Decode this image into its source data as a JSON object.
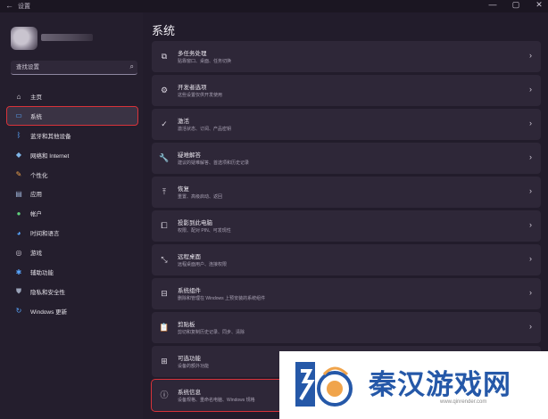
{
  "window": {
    "title": "设置",
    "controls": [
      "—",
      "▢",
      "✕"
    ]
  },
  "sidebar": {
    "search_placeholder": "查找设置",
    "items": [
      {
        "label": "主页",
        "icon": "home-icon",
        "glyph": "⌂",
        "color": "#e6e3ea"
      },
      {
        "label": "系统",
        "icon": "system-display-icon",
        "glyph": "▭",
        "color": "#58a6ff",
        "active": true
      },
      {
        "label": "蓝牙和其他设备",
        "icon": "bluetooth-icon",
        "glyph": "ᛒ",
        "color": "#58a6ff"
      },
      {
        "label": "网络和 Internet",
        "icon": "network-icon",
        "glyph": "◆",
        "color": "#7fb5e8"
      },
      {
        "label": "个性化",
        "icon": "brush-icon",
        "glyph": "✎",
        "color": "#f0a44b"
      },
      {
        "label": "应用",
        "icon": "apps-icon",
        "glyph": "▤",
        "color": "#9fb4d8"
      },
      {
        "label": "帐户",
        "icon": "account-icon",
        "glyph": "●",
        "color": "#5fd07b"
      },
      {
        "label": "时间和语言",
        "icon": "globe-clock-icon",
        "glyph": "◕",
        "color": "#58a6ff"
      },
      {
        "label": "游戏",
        "icon": "gamepad-icon",
        "glyph": "◎",
        "color": "#cfc9d6"
      },
      {
        "label": "辅助功能",
        "icon": "accessibility-icon",
        "glyph": "✱",
        "color": "#58a6ff"
      },
      {
        "label": "隐私和安全性",
        "icon": "shield-icon",
        "glyph": "⛊",
        "color": "#9aa3b8"
      },
      {
        "label": "Windows 更新",
        "icon": "windows-update-icon",
        "glyph": "↻",
        "color": "#58a6ff"
      }
    ]
  },
  "main": {
    "title": "系统",
    "cards": [
      {
        "title": "多任务处理",
        "desc": "贴靠窗口、桌面、任务切换",
        "icon": "multitasking-icon",
        "glyph": "⧉"
      },
      {
        "title": "开发者选项",
        "desc": "这些设置仅供开发使用",
        "icon": "developer-icon",
        "glyph": "⚙"
      },
      {
        "title": "激活",
        "desc": "激活状态、订阅、产品密钥",
        "icon": "activation-icon",
        "glyph": "✓"
      },
      {
        "title": "疑难解答",
        "desc": "建议的疑难解答、首选项和历史记录",
        "icon": "wrench-icon",
        "glyph": "🔧"
      },
      {
        "title": "恢复",
        "desc": "重置、高级启动、返回",
        "icon": "recovery-icon",
        "glyph": "⤒"
      },
      {
        "title": "投影到此电脑",
        "desc": "权限、配对 PIN、可发现性",
        "icon": "projection-icon",
        "glyph": "⧠"
      },
      {
        "title": "远程桌面",
        "desc": "远程桌面用户、连接权限",
        "icon": "remote-desktop-icon",
        "glyph": "⤡"
      },
      {
        "title": "系统组件",
        "desc": "删除和管理在 Windows 上预安装的系统组件",
        "icon": "components-icon",
        "glyph": "⊟"
      },
      {
        "title": "剪贴板",
        "desc": "剪切和复制历史记录、同步、清除",
        "icon": "clipboard-icon",
        "glyph": "📋"
      },
      {
        "title": "可选功能",
        "desc": "设备的额外功能",
        "icon": "optional-features-icon",
        "glyph": "⊞"
      },
      {
        "title": "系统信息",
        "desc": "设备规格、重命名电脑、Windows 规格",
        "icon": "info-icon",
        "glyph": "ⓘ",
        "highlight": true
      }
    ],
    "chevron": "›"
  },
  "watermark": {
    "text": "秦汉游戏网",
    "url": "www.qinrender.com",
    "colors": {
      "primary": "#2558a8",
      "accent": "#f0a44b"
    }
  }
}
